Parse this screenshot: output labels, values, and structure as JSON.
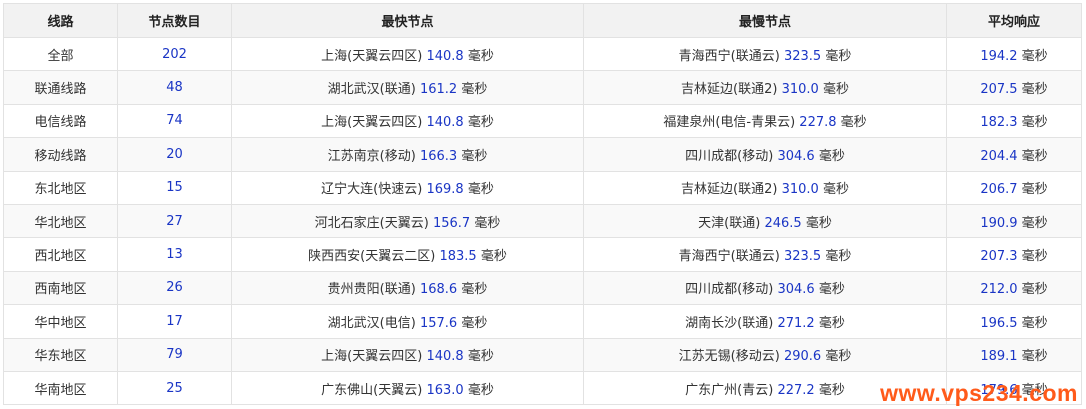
{
  "table": {
    "headers": [
      "线路",
      "节点数目",
      "最快节点",
      "最慢节点",
      "平均响应"
    ],
    "rows": [
      {
        "route": "全部",
        "count": "202",
        "fastest_node": "上海(天翼云四区)",
        "fastest_ms": "140.8",
        "slowest_node": "青海西宁(联通云)",
        "slowest_ms": "323.5",
        "avg_ms": "194.2"
      },
      {
        "route": "联通线路",
        "count": "48",
        "fastest_node": "湖北武汉(联通)",
        "fastest_ms": "161.2",
        "slowest_node": "吉林延边(联通2)",
        "slowest_ms": "310.0",
        "avg_ms": "207.5"
      },
      {
        "route": "电信线路",
        "count": "74",
        "fastest_node": "上海(天翼云四区)",
        "fastest_ms": "140.8",
        "slowest_node": "福建泉州(电信-青果云)",
        "slowest_ms": "227.8",
        "avg_ms": "182.3"
      },
      {
        "route": "移动线路",
        "count": "20",
        "fastest_node": "江苏南京(移动)",
        "fastest_ms": "166.3",
        "slowest_node": "四川成都(移动)",
        "slowest_ms": "304.6",
        "avg_ms": "204.4"
      },
      {
        "route": "东北地区",
        "count": "15",
        "fastest_node": "辽宁大连(快速云)",
        "fastest_ms": "169.8",
        "slowest_node": "吉林延边(联通2)",
        "slowest_ms": "310.0",
        "avg_ms": "206.7"
      },
      {
        "route": "华北地区",
        "count": "27",
        "fastest_node": "河北石家庄(天翼云)",
        "fastest_ms": "156.7",
        "slowest_node": "天津(联通)",
        "slowest_ms": "246.5",
        "avg_ms": "190.9"
      },
      {
        "route": "西北地区",
        "count": "13",
        "fastest_node": "陕西西安(天翼云二区)",
        "fastest_ms": "183.5",
        "slowest_node": "青海西宁(联通云)",
        "slowest_ms": "323.5",
        "avg_ms": "207.3"
      },
      {
        "route": "西南地区",
        "count": "26",
        "fastest_node": "贵州贵阳(联通)",
        "fastest_ms": "168.6",
        "slowest_node": "四川成都(移动)",
        "slowest_ms": "304.6",
        "avg_ms": "212.0"
      },
      {
        "route": "华中地区",
        "count": "17",
        "fastest_node": "湖北武汉(电信)",
        "fastest_ms": "157.6",
        "slowest_node": "湖南长沙(联通)",
        "slowest_ms": "271.2",
        "avg_ms": "196.5"
      },
      {
        "route": "华东地区",
        "count": "79",
        "fastest_node": "上海(天翼云四区)",
        "fastest_ms": "140.8",
        "slowest_node": "江苏无锡(移动云)",
        "slowest_ms": "290.6",
        "avg_ms": "189.1"
      },
      {
        "route": "华南地区",
        "count": "25",
        "fastest_node": "广东佛山(天翼云)",
        "fastest_ms": "163.0",
        "slowest_node": "广东广州(青云)",
        "slowest_ms": "227.2",
        "avg_ms": "179.6"
      }
    ],
    "unit": "毫秒"
  },
  "watermark": "www.vps234.com",
  "colors": {
    "number": "#1a35c5",
    "header_bg": "#f2f2f2",
    "border": "#e2e2e2",
    "watermark": "#ff5a1a"
  }
}
